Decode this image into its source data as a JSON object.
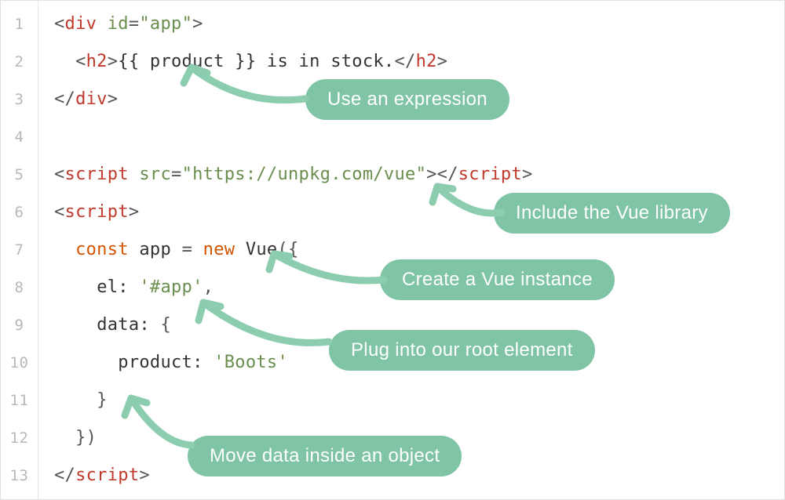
{
  "gutter": {
    "line_numbers": [
      "1",
      "2",
      "3",
      "4",
      "5",
      "6",
      "7",
      "8",
      "9",
      "10",
      "11",
      "12",
      "13"
    ]
  },
  "code": {
    "l1": {
      "open": "<",
      "tag": "div",
      "sp": " ",
      "attr": "id",
      "eq": "=",
      "q1": "\"",
      "val": "app",
      "q2": "\"",
      "close": ">"
    },
    "l2": {
      "indent": "  ",
      "open1": "<",
      "tag1": "h2",
      "close1": ">",
      "expr": "{{ product }}",
      "text": " is in stock.",
      "open2": "</",
      "tag2": "h2",
      "close2": ">"
    },
    "l3": {
      "open": "</",
      "tag": "div",
      "close": ">"
    },
    "l4": {
      "blank": ""
    },
    "l5": {
      "open1": "<",
      "tag1": "script",
      "sp": " ",
      "attr": "src",
      "eq": "=",
      "q1": "\"",
      "val": "https://unpkg.com/vue",
      "q2": "\"",
      "close1": ">",
      "open2": "</",
      "tag2": "script",
      "close2": ">"
    },
    "l6": {
      "open": "<",
      "tag": "script",
      "close": ">"
    },
    "l7": {
      "indent": "  ",
      "kw1": "const",
      "sp1": " ",
      "id1": "app",
      "sp2": " ",
      "eq": "=",
      "sp3": " ",
      "kw2": "new",
      "sp4": " ",
      "id2": "Vue",
      "paren": "({"
    },
    "l8": {
      "indent": "    ",
      "prop": "el:",
      "sp": " ",
      "str": "'#app'",
      "comma": ","
    },
    "l9": {
      "indent": "    ",
      "prop": "data:",
      "sp": " ",
      "brace": "{"
    },
    "l10": {
      "indent": "      ",
      "prop": "product:",
      "sp": " ",
      "str": "'Boots'"
    },
    "l11": {
      "indent": "    ",
      "brace": "}"
    },
    "l12": {
      "indent": "  ",
      "close": "})"
    },
    "l13": {
      "open": "</",
      "tag": "script",
      "close": ">"
    }
  },
  "callouts": {
    "c1": "Use an expression",
    "c2": "Include the Vue library",
    "c3": "Create a Vue instance",
    "c4": "Plug into our root element",
    "c5": "Move data inside an object"
  }
}
